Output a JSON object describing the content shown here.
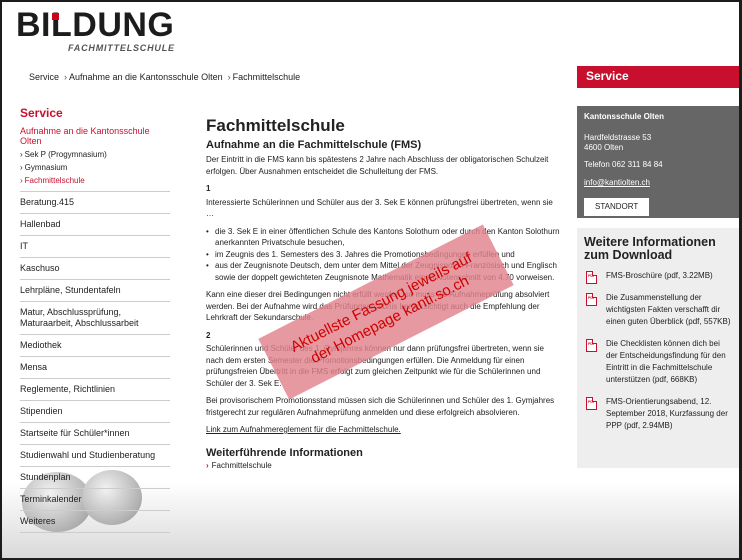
{
  "logo": {
    "main": "BILDUNG",
    "sub": "FACHMITTELSCHULE"
  },
  "breadcrumb": [
    "Service",
    "Aufnahme an die Kantonsschule Olten",
    "Fachmittelschule"
  ],
  "sidebar": {
    "title": "Service",
    "section": "Aufnahme an die Kantonsschule Olten",
    "subitems": [
      "Sek P (Progymnasium)",
      "Gymnasium",
      "Fachmittelschule"
    ],
    "items": [
      "Beratung.415",
      "Hallenbad",
      "IT",
      "Kaschuso",
      "Lehrpläne, Stundentafeln",
      "Matur, Abschlussprüfung, Maturaarbeit, Abschlussarbeit",
      "Mediothek",
      "Mensa",
      "Reglemente, Richtlinien",
      "Stipendien",
      "Startseite für Schüler*innen",
      "Studienwahl und Studienberatung",
      "Stundenplan",
      "Terminkalender",
      "Weiteres"
    ]
  },
  "main": {
    "title": "Fachmittelschule",
    "subtitle": "Aufnahme an die Fachmittelschule (FMS)",
    "intro": "Der Eintritt in die FMS kann bis spätestens 2 Jahre nach Abschluss der obligatorischen Schulzeit erfolgen. Über Ausnahmen entscheidet die Schulleitung der FMS.",
    "s1_num": "1",
    "s1_text": "Interessierte Schülerinnen und Schüler aus der 3. Sek E können prüfungsfrei übertreten, wenn sie …",
    "s1_list": [
      "die 3. Sek E in einer öffentlichen Schule des Kantons Solothurn oder durch den Kanton Solothurn anerkannten Privatschule besuchen,",
      "im Zeugnis des 1. Semesters des 3. Jahres die Promotionsbedingungen erfüllen und",
      "aus der Zeugnisnote Deutsch, dem unter dem Mittel der Zeugnisnoten Französisch und Englisch sowie der doppelt gewichteten Zeugnisnote Mathematik einen Notenschnitt von 4.70 vorweisen."
    ],
    "s1_after": "Kann eine dieser drei Bedingungen nicht erfüllt werden, so muss die Aufnahmeprüfung absolviert werden. Bei der Aufnahme wird das Prüfungsergebnis berücksichtigt auch die Empfehlung der Lehrkraft der Sekundarschule.",
    "s2_num": "2",
    "s2_text": "Schülerinnen und Schüler des 1. Gymjahres können nur dann prüfungsfrei übertreten, wenn sie nach dem ersten Semester die Promotionsbedingungen erfüllen. Die Anmeldung für einen prüfungsfreien Übertritt in die FMS erfolgt zum gleichen Zeitpunkt wie für die Schülerinnen und Schüler der 3. Sek E.",
    "s2_after": "Bei provisorischem Promotionsstand müssen sich die Schülerinnen und Schüler des 1. Gymjahres fristgerecht zur regulären Aufnahmeprüfung anmelden und diese erfolgreich absolvieren.",
    "link": "Link zum Aufnahmereglement für die Fachmittelschule.",
    "more_title": "Weiterführende Informationen",
    "more_link": "Fachmittelschule"
  },
  "right": {
    "service": "Service",
    "contact": {
      "title": "Kantonsschule Olten",
      "street": "Hardfeldstrasse 53",
      "city": "4600 Olten",
      "phone": "Telefon 062 311 84 84",
      "email": "info@kantiolten.ch",
      "button": "STANDORT"
    },
    "downloads": {
      "title": "Weitere Informationen zum Download",
      "items": [
        "FMS-Broschüre (pdf, 3.22MB)",
        "Die Zusammenstellung der wichtigsten Fakten verschafft dir einen guten Überblick (pdf, 557KB)",
        "Die Checklisten können dich bei der Entscheidungsfindung für den Eintritt in die Fachmittelschule unterstützen (pdf, 668KB)",
        "FMS-Orientierungsabend, 12. September 2018, Kurzfassung der PPP (pdf, 2.94MB)"
      ]
    }
  },
  "stamp": {
    "line1": "Aktuellste Fassung jeweils auf",
    "line2": "der Homepage kanti.so.ch"
  },
  "colors": {
    "accent": "#c8102e",
    "panel": "#666666",
    "download_bg": "#eeeeee"
  }
}
